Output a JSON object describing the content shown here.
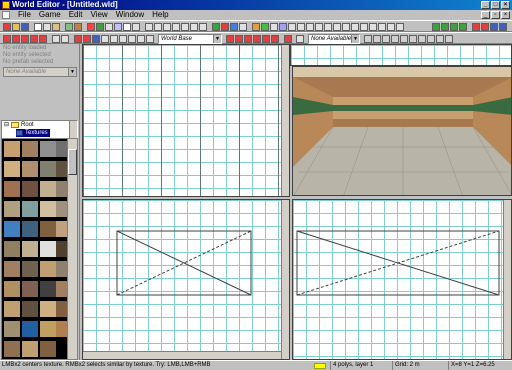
{
  "window": {
    "title": "World Editor - [Untitled.wld]"
  },
  "menu": [
    "File",
    "Game",
    "Edit",
    "View",
    "Window",
    "Help"
  ],
  "toolbar": {
    "world_combo": "World Base",
    "texture_combo": "None Available"
  },
  "left_panel": {
    "props": [
      "No entity loaded",
      "No entity selected",
      "No prefab selected"
    ],
    "combo": "None Available",
    "tree": {
      "root": "Root",
      "child": "Textures"
    }
  },
  "status": {
    "hint": "LMBx2 centers texture. RMBx2 selects similar by texture. Try: LMB,LMB+RMB",
    "polys": "4 polys, layer 1",
    "grid": "Grid: 2 m",
    "coords": "X=8 Y=1 Z=6.25"
  },
  "colors": {
    "title_bar": "#000080",
    "grid_line": "#7fcfcf",
    "background": "#c0c0c0",
    "status_marker": "#ffff00"
  }
}
